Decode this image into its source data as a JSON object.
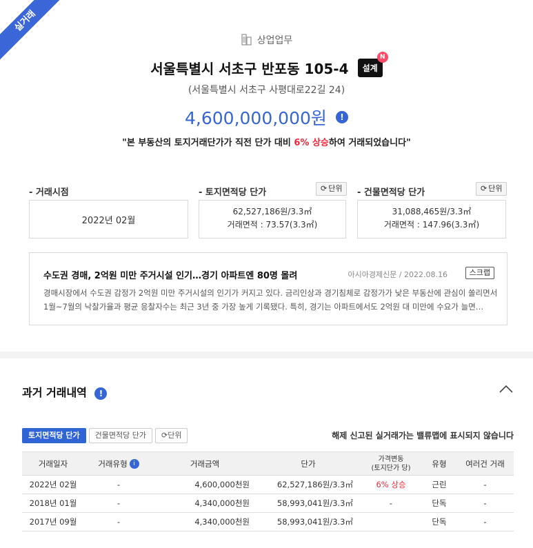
{
  "ribbon": "실거래",
  "category": "상업업무",
  "title": "서울특별시 서초구 반포동 105-4",
  "badge": "설계",
  "badge_new": "N",
  "road_address": "(서울특별시 서초구 사평대로22길 24)",
  "price": "4,600,000,000원",
  "quote": {
    "before": "\"본 부동산의 토지거래단가가 직전 단가 대비 ",
    "highlight": "6% 상승",
    "after": "하여 거래되었습니다\""
  },
  "fields": {
    "date_label": "- 거래시점",
    "date_value": "2022년 02월",
    "land_label": "- 토지면적당 단가",
    "land_price": "62,527,186원/3.3㎡",
    "land_area": "거래면적 : 73.57(3.3㎡)",
    "bldg_label": "- 건물면적당 단가",
    "bldg_price": "31,088,465원/3.3㎡",
    "bldg_area": "거래면적 : 147.96(3.3㎡)",
    "unit_btn": "단위"
  },
  "news": {
    "title": "수도권 경매, 2억원 미만 주거시설 인기…경기 아파트엔 80명 몰려",
    "source": "아시아경제신문  /  2022.08.16",
    "scrap": "스크랩",
    "body": "경매시장에서 수도권 감정가 2억원 미만 주거시설의 인기가 커지고 있다. 금리인상과 경기침체로 감정가가 낮은 부동산에 관심이 쏠리면서 1월~7월의 낙찰가율과 평균 응찰자수는 최근 3년 중 가장 높게 기록됐다. 특히, 경기는 아파트에서도 2억원 대 미만에 수요가 늘면…"
  },
  "history": {
    "title": "과거 거래내역",
    "tabs": [
      "토지면적당 단가",
      "건물면적당 단가"
    ],
    "unit_btn": "단위",
    "notice": "해제 신고된 실거래가는 밸류맵에 표시되지 않습니다",
    "columns": [
      "거래일자",
      "거래유형",
      "거래금액",
      "단가",
      "가격변동",
      "(토지단가 당)",
      "유형",
      "여러건 거래"
    ],
    "rows": [
      [
        "2022년 02월",
        "-",
        "4,600,000천원",
        "62,527,186원/3.3㎡",
        "6% 상승",
        "근린",
        "-"
      ],
      [
        "2018년 01월",
        "-",
        "4,340,000천원",
        "58,993,041원/3.3㎡",
        "-",
        "단독",
        "-"
      ],
      [
        "2017년 09월",
        "-",
        "4,340,000천원",
        "58,993,041원/3.3㎡",
        "",
        "단독",
        "-"
      ]
    ]
  },
  "colors": {
    "accent": "#3565d6",
    "up": "#ee2a3a",
    "ribbon": "#3a66d8"
  }
}
